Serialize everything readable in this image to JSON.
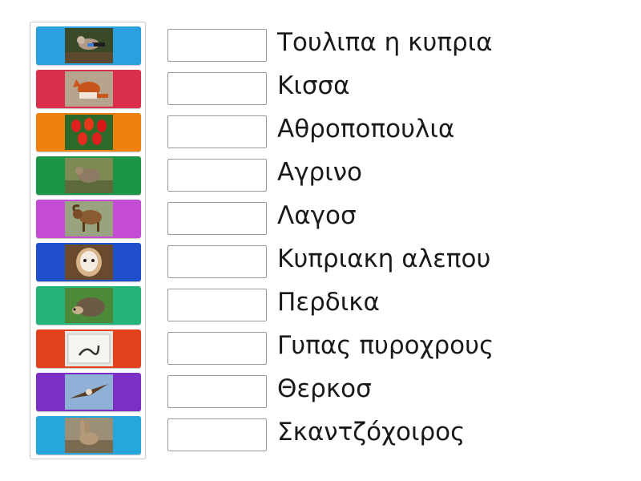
{
  "tiles": [
    {
      "color": "#2aa0de",
      "image": "jay-bird-photo"
    },
    {
      "color": "#db2e4c",
      "image": "fox-photo"
    },
    {
      "color": "#f0810f",
      "image": "tulips-photo"
    },
    {
      "color": "#1c9547",
      "image": "partridge-photo"
    },
    {
      "color": "#c44bd4",
      "image": "mouflon-photo"
    },
    {
      "color": "#1f4fcb",
      "image": "barn-owl-photo"
    },
    {
      "color": "#25b479",
      "image": "hedgehog-photo"
    },
    {
      "color": "#e2411c",
      "image": "snake-sign-photo"
    },
    {
      "color": "#7b2fc3",
      "image": "vulture-photo"
    },
    {
      "color": "#25a7db",
      "image": "hare-photo"
    }
  ],
  "labels": [
    "Τουλιπα η κυπρια",
    "Κισσα",
    "Αθροποπουλια",
    "Αγρινο",
    "Λαγοσ",
    "Κυπριακη αλεπου",
    "Περδικα",
    "Γυπας πυροχρους",
    "Θερκοσ",
    "Σκαντζόχοιρος"
  ]
}
